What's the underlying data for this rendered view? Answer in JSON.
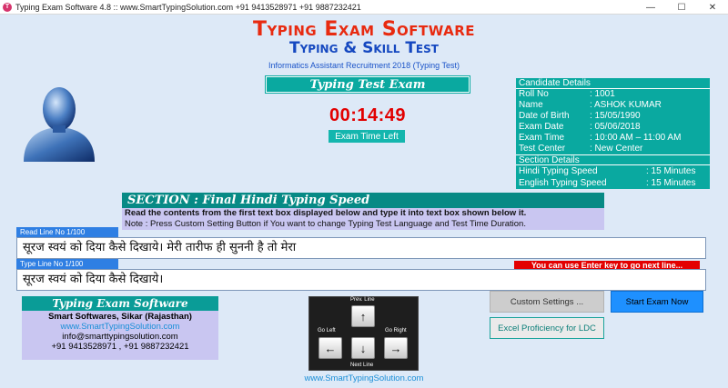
{
  "window": {
    "title": "Typing Exam Software 4.8 :: www.SmartTypingSolution.com  +91 9413528971  +91 9887232421",
    "icon_letter": "T",
    "controls": [
      "—",
      "☐",
      "✕"
    ]
  },
  "header": {
    "title": "Typing Exam Software",
    "subtitle": "Typing & Skill Test",
    "recruitment": "Informatics Assistant Recruitment 2018 (Typing Test)"
  },
  "exam": {
    "banner": "Typing Test Exam",
    "timer": "00:14:49",
    "time_left_label": "Exam Time Left"
  },
  "candidate": {
    "heading": "Candidate Details",
    "fields": [
      {
        "label": "Roll No",
        "value": ": 1001"
      },
      {
        "label": "Name",
        "value": ": ASHOK KUMAR"
      },
      {
        "label": "Date of Birth",
        "value": ": 15/05/1990"
      },
      {
        "label": "Exam Date",
        "value": ": 05/06/2018"
      },
      {
        "label": "Exam Time",
        "value": ": 10:00 AM – 11:00 AM"
      },
      {
        "label": "Test Center",
        "value": ": New Center"
      }
    ],
    "section_heading": "Section Details",
    "sections": [
      {
        "label": "Hindi Typing Speed",
        "value": ": 15 Minutes"
      },
      {
        "label": "English Typing Speed",
        "value": ": 15 Minutes"
      }
    ]
  },
  "section": {
    "title": "SECTION : Final Hindi Typing Speed",
    "instruction": "Read the contents from the first text box displayed below and type it into text box shown below it.",
    "note": "Note : Press Custom Setting Button if You want to change Typing Test Language and Test Time Duration."
  },
  "read_line": {
    "label": "Read Line No 1/100",
    "text": "सूरज स्वयं को दिया कैसे दिखाये। मेरी तारीफ ही सुननी है तो मेरा"
  },
  "type_line": {
    "label": "Type Line No 1/100",
    "text": "सूरज स्वयं को दिया कैसे दिखाये।"
  },
  "enter_note": "You can use Enter key to go next line...",
  "info": {
    "title": "Typing Exam Software",
    "company": "Smart Softwares, Sikar (Rajasthan)",
    "website": "www.SmartTypingSolution.com",
    "email": "info@smarttypingsolution.com",
    "phones": "+91 9413528971 , +91 9887232421"
  },
  "keys": {
    "prev_label": "Prev. Line",
    "left_label": "Go Left",
    "right_label": "Go Right",
    "next_label": "Next Line",
    "up": "↑",
    "down": "↓",
    "left": "←",
    "right": "→"
  },
  "footer_link": "www.SmartTypingSolution.com",
  "buttons": {
    "custom": "Custom Settings ...",
    "start": "Start Exam Now",
    "excel": "Excel Proficiency for LDC"
  }
}
